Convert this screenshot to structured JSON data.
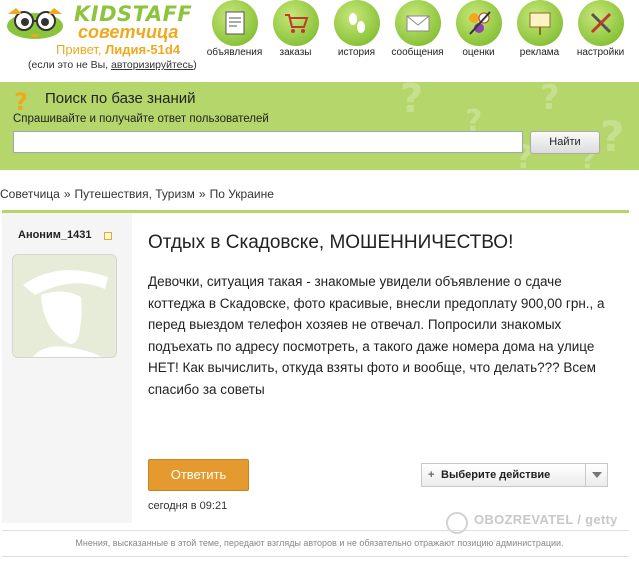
{
  "header": {
    "brand": "KIDSTAFF",
    "brand_sub": "советчица",
    "greeting_prefix": "Привет, ",
    "username": "Лидия-51d4",
    "not_you_prefix": "(если это не Вы, ",
    "auth_link": "авторизируйтесь",
    "not_you_suffix": ")",
    "nav": [
      {
        "label": "объявления",
        "icon": "ads-icon"
      },
      {
        "label": "заказы",
        "icon": "cart-icon"
      },
      {
        "label": "история",
        "icon": "footprints-icon"
      },
      {
        "label": "сообщения",
        "icon": "envelope-icon"
      },
      {
        "label": "оценки",
        "icon": "ratings-icon"
      },
      {
        "label": "реклама",
        "icon": "billboard-icon"
      },
      {
        "label": "настройки",
        "icon": "tools-icon"
      }
    ],
    "accent_color": "#8cc43c",
    "orange_color": "#f0a91e"
  },
  "search": {
    "title": "Поиск по базе знаний",
    "subtitle": "Спрашивайте и получайте ответ пользователей",
    "value": "",
    "button": "Найти",
    "bg_color": "#b5d66a"
  },
  "breadcrumb": {
    "items": [
      "Советчица",
      "Путешествия, Туризм",
      "По Украине"
    ],
    "separator": "»"
  },
  "post": {
    "author": "Аноним_1431",
    "title": "Отдых в Скадовске, МОШЕННИЧЕСТВО!",
    "body": "Девочки, ситуация такая - знакомые увидели объявление о сдаче коттеджа в Скадовске, фото красивые, внесли предоплату 900,00 грн., а перед выездом телефон хозяев не отвечал. Попросили знакомых подъехать по адресу посмотреть, а такого даже номера дома на улице НЕТ! Как вычислить, откуда взяты фото и вообще, что делать??? Всем спасибо за советы",
    "reply_button": "Ответить",
    "action_select": "Выберите действие",
    "timestamp": "сегодня в 09:21",
    "reply_color": "#e49a2e"
  },
  "watermark": "OBOZREVATEL / getty",
  "footer": {
    "disclaimer": "Мнения, высказанные в этой теме, передают взгляды авторов и не обязательно отражают позицию администрации."
  }
}
